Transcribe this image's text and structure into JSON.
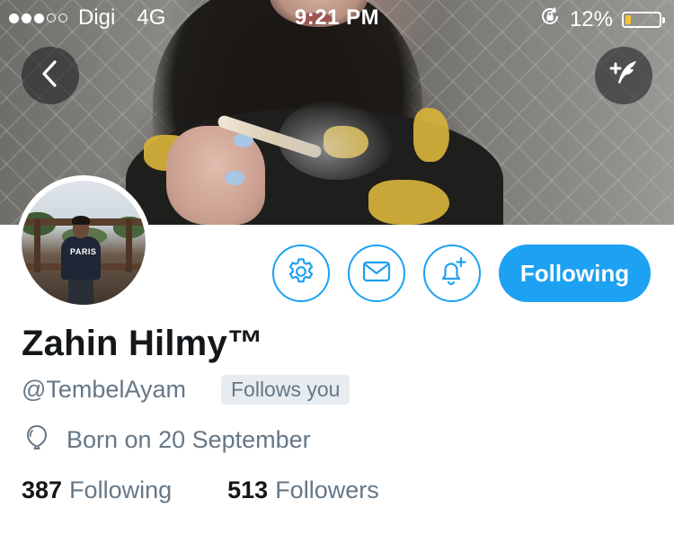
{
  "status_bar": {
    "carrier": "Digi",
    "network": "4G",
    "time": "9:21 PM",
    "battery_percent": "12%",
    "signal_bars_filled": 3,
    "signal_bars_total": 5
  },
  "header": {
    "back_icon": "chevron-left-icon",
    "compose_icon": "compose-tweet-icon"
  },
  "actions": {
    "settings_icon": "gear-icon",
    "message_icon": "envelope-icon",
    "notifications_icon": "bell-plus-icon",
    "following_label": "Following"
  },
  "profile": {
    "name": "Zahin Hilmy™",
    "handle": "@TembelAyam",
    "follows_you": "Follows you",
    "birth": "Born on 20 September",
    "birth_icon": "balloon-icon",
    "avatar_shirt_text": "PARIS",
    "following_count": "387",
    "following_label": "Following",
    "followers_count": "513",
    "followers_label": "Followers"
  },
  "colors": {
    "accent": "#1da1f2",
    "text_primary": "#14171a",
    "text_secondary": "#657786",
    "badge_bg": "#e6ecf0",
    "battery_low": "#f4c533"
  }
}
